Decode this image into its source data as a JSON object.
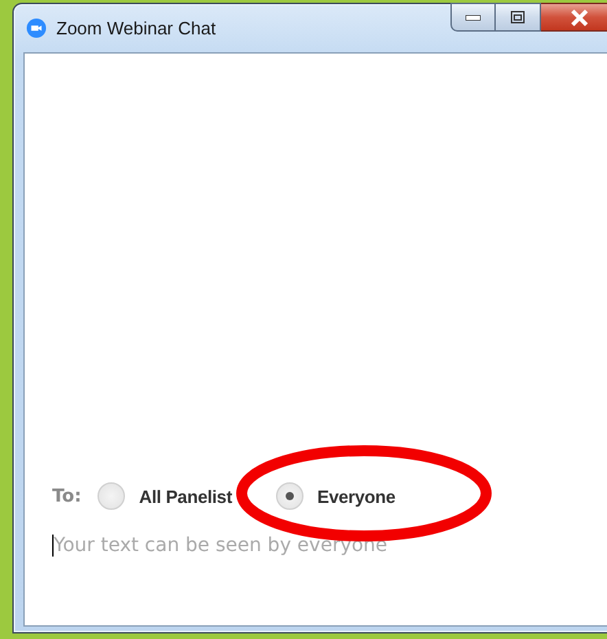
{
  "window": {
    "title": "Zoom Webinar Chat"
  },
  "recipients": {
    "label": "To:",
    "options": [
      {
        "label": "All Panelist",
        "selected": false
      },
      {
        "label": "Everyone",
        "selected": true
      }
    ]
  },
  "message": {
    "placeholder": "Your text can be seen by everyone"
  }
}
